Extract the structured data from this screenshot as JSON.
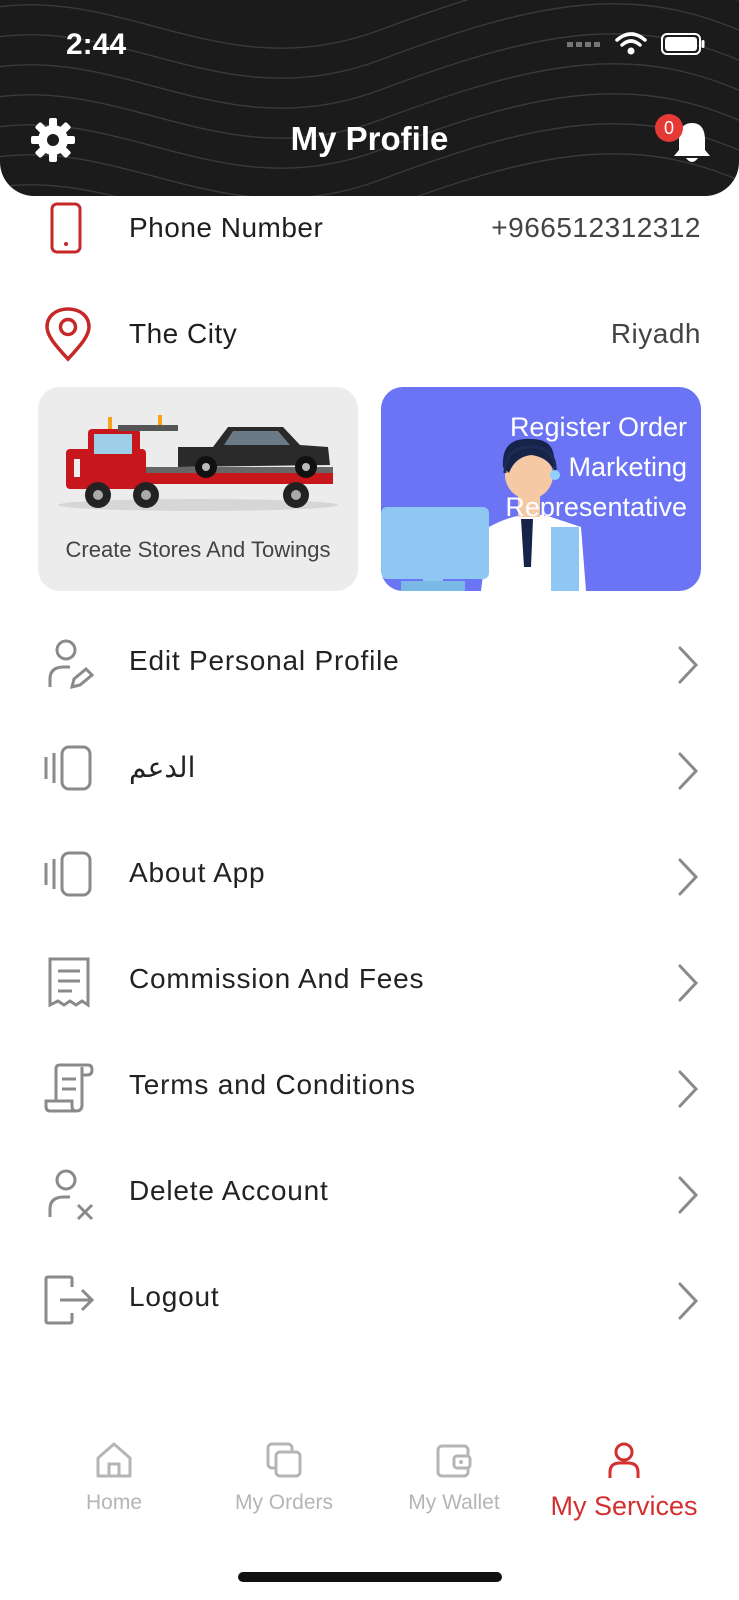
{
  "status_bar": {
    "time": "2:44"
  },
  "header": {
    "title": "My Profile",
    "notification_count": "0"
  },
  "info": [
    {
      "label": "Phone Number",
      "value": "+966512312312",
      "icon": "phone-icon"
    },
    {
      "label": "The City",
      "value": "Riyadh",
      "icon": "location-pin-icon"
    }
  ],
  "cards": {
    "left": {
      "label": "Create Stores And Towings"
    },
    "right": {
      "label": "Register Order Marketing Representative"
    }
  },
  "menu": [
    {
      "label": "Edit Personal Profile",
      "icon": "edit-user-icon"
    },
    {
      "label": "الدعم",
      "icon": "support-icon"
    },
    {
      "label": "About App",
      "icon": "info-cards-icon"
    },
    {
      "label": "Commission And Fees",
      "icon": "receipt-icon"
    },
    {
      "label": "Terms and Conditions",
      "icon": "scroll-icon"
    },
    {
      "label": "Delete Account",
      "icon": "user-remove-icon"
    },
    {
      "label": "Logout",
      "icon": "logout-icon"
    }
  ],
  "tabs": [
    {
      "label": "Home",
      "icon": "home-icon"
    },
    {
      "label": "My Orders",
      "icon": "orders-icon"
    },
    {
      "label": "My Wallet",
      "icon": "wallet-icon"
    },
    {
      "label": "My Services",
      "icon": "user-icon",
      "active": true
    }
  ],
  "colors": {
    "accent": "#d32f2f",
    "header": "#1b1b1b",
    "card_blue": "#6b74f5",
    "card_grey": "#ececec"
  }
}
